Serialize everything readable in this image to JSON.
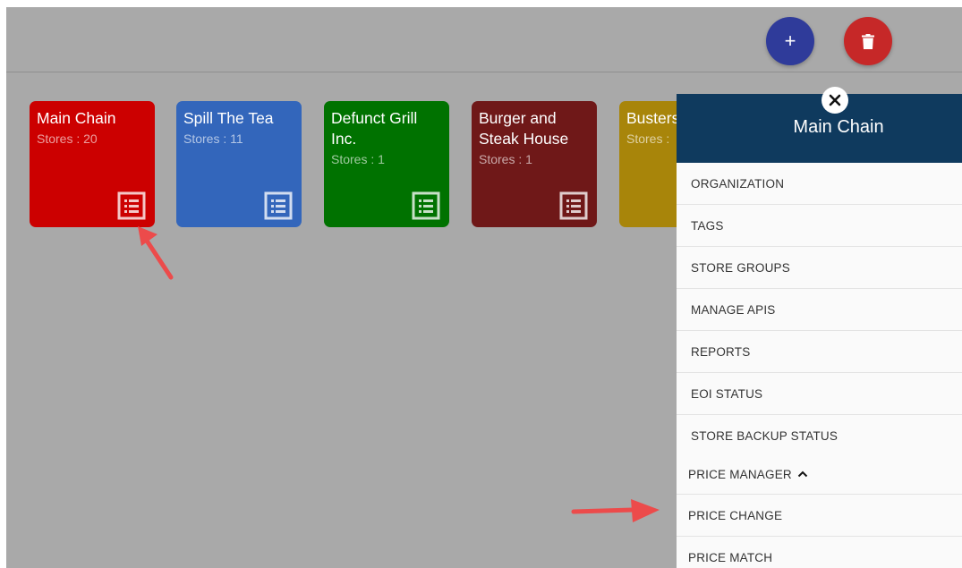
{
  "toolbar": {
    "add_label": "+",
    "add_color": "#2f3b9a",
    "delete_color": "#c62828"
  },
  "chains": [
    {
      "name": "Main Chain",
      "stores": "Stores : 20",
      "color": "#cc0000"
    },
    {
      "name": "Spill The Tea",
      "stores": "Stores : 11",
      "color": "#3366bb"
    },
    {
      "name": "Defunct Grill Inc.",
      "stores": "Stores : 1",
      "color": "#007200"
    },
    {
      "name": "Burger and Steak House",
      "stores": "Stores : 1",
      "color": "#6f1818"
    },
    {
      "name": "Busters",
      "stores": "Stores :",
      "color": "#a8850a"
    }
  ],
  "panel": {
    "title": "Main Chain",
    "header_color": "#0f3a5e",
    "menu": [
      "ORGANIZATION",
      "TAGS",
      "STORE GROUPS",
      "MANAGE APIS",
      "REPORTS",
      "EOI STATUS",
      "STORE BACKUP STATUS"
    ],
    "price_manager": {
      "label": "PRICE MANAGER",
      "items": [
        "PRICE CHANGE",
        "PRICE MATCH"
      ]
    }
  },
  "annotation_color": "#ec4b4b"
}
